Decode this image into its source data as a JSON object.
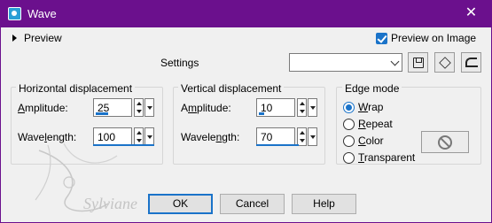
{
  "window": {
    "title": "Wave",
    "close_glyph": "✕",
    "app_icon": "app-icon"
  },
  "preview": {
    "label": "Preview",
    "icon": "chevron-right-icon"
  },
  "preview_on_image": {
    "label": "Preview on Image",
    "checked": true
  },
  "settings": {
    "label": "Settings",
    "value": ""
  },
  "horizontal": {
    "title": "Horizontal displacement",
    "amplitude_label_u": "A",
    "amplitude_label_rest": "mplitude:",
    "amplitude_value": "25",
    "wavelength_label_pre": "Wave",
    "wavelength_label_u": "l",
    "wavelength_label_rest": "ength:",
    "wavelength_value": "100"
  },
  "vertical": {
    "title": "Vertical displacement",
    "amplitude_label_pre": "A",
    "amplitude_label_u": "m",
    "amplitude_label_rest": "plitude:",
    "amplitude_value": "10",
    "wavelength_label_pre": "Wavele",
    "wavelength_label_u": "n",
    "wavelength_label_rest": "gth:",
    "wavelength_value": "70"
  },
  "edge_mode": {
    "title": "Edge mode",
    "options": [
      {
        "u": "W",
        "rest": "rap",
        "selected": true
      },
      {
        "u": "R",
        "rest": "epeat",
        "selected": false
      },
      {
        "u": "C",
        "rest": "olor",
        "selected": false
      },
      {
        "u": "T",
        "rest": "ransparent",
        "selected": false
      }
    ]
  },
  "buttons": {
    "ok": "OK",
    "cancel": "Cancel",
    "help": "Help"
  },
  "watermark": {
    "text": "Sylviane"
  },
  "colors": {
    "titlebar": "#6b108d",
    "accent": "#1a73c9"
  }
}
